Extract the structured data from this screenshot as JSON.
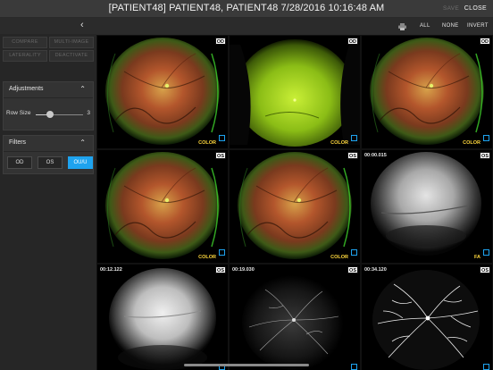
{
  "titlebar": {
    "title": "[PATIENT48] PATIENT48, PATIENT48  7/28/2016 10:16:48 AM",
    "save_label": "SAVE",
    "close_label": "CLOSE"
  },
  "sidebar": {
    "collapse_glyph": "‹",
    "buttons": [
      "COMPARE",
      "MULTI-IMAGE",
      "LATERALITY",
      "DEACTIVATE"
    ],
    "adjustments": {
      "title": "Adjustments",
      "chevron": "⌃",
      "row_size_label": "Row Size",
      "row_size_value": "3",
      "row_size_fraction": 0.3
    },
    "filters": {
      "title": "Filters",
      "chevron": "⌃",
      "options": [
        "OD",
        "OS",
        "OU/U"
      ],
      "selected": "OU/U"
    }
  },
  "toolbar": {
    "print_icon": "printer-icon",
    "all_label": "ALL",
    "none_label": "NONE",
    "invert_label": "INVERT"
  },
  "tiles": [
    {
      "eye": "OD",
      "timestamp": "",
      "mode": "COLOR",
      "kind": "color"
    },
    {
      "eye": "OD",
      "timestamp": "",
      "mode": "COLOR",
      "kind": "green"
    },
    {
      "eye": "OD",
      "timestamp": "",
      "mode": "COLOR",
      "kind": "color"
    },
    {
      "eye": "OS",
      "timestamp": "",
      "mode": "COLOR",
      "kind": "color"
    },
    {
      "eye": "OS",
      "timestamp": "",
      "mode": "COLOR",
      "kind": "color"
    },
    {
      "eye": "OS",
      "timestamp": "00:00.015",
      "mode": "FA",
      "kind": "fa-early"
    },
    {
      "eye": "OS",
      "timestamp": "00:12.122",
      "mode": "",
      "kind": "fa-bright"
    },
    {
      "eye": "OS",
      "timestamp": "00:19.030",
      "mode": "",
      "kind": "fa-vessel-dim"
    },
    {
      "eye": "OS",
      "timestamp": "00:34.120",
      "mode": "",
      "kind": "fa-vessel"
    }
  ],
  "colors": {
    "accent": "#1ea3ef",
    "mode_label": "#ffd83d",
    "panel": "#333333",
    "titlebar": "#3a3a3a"
  }
}
